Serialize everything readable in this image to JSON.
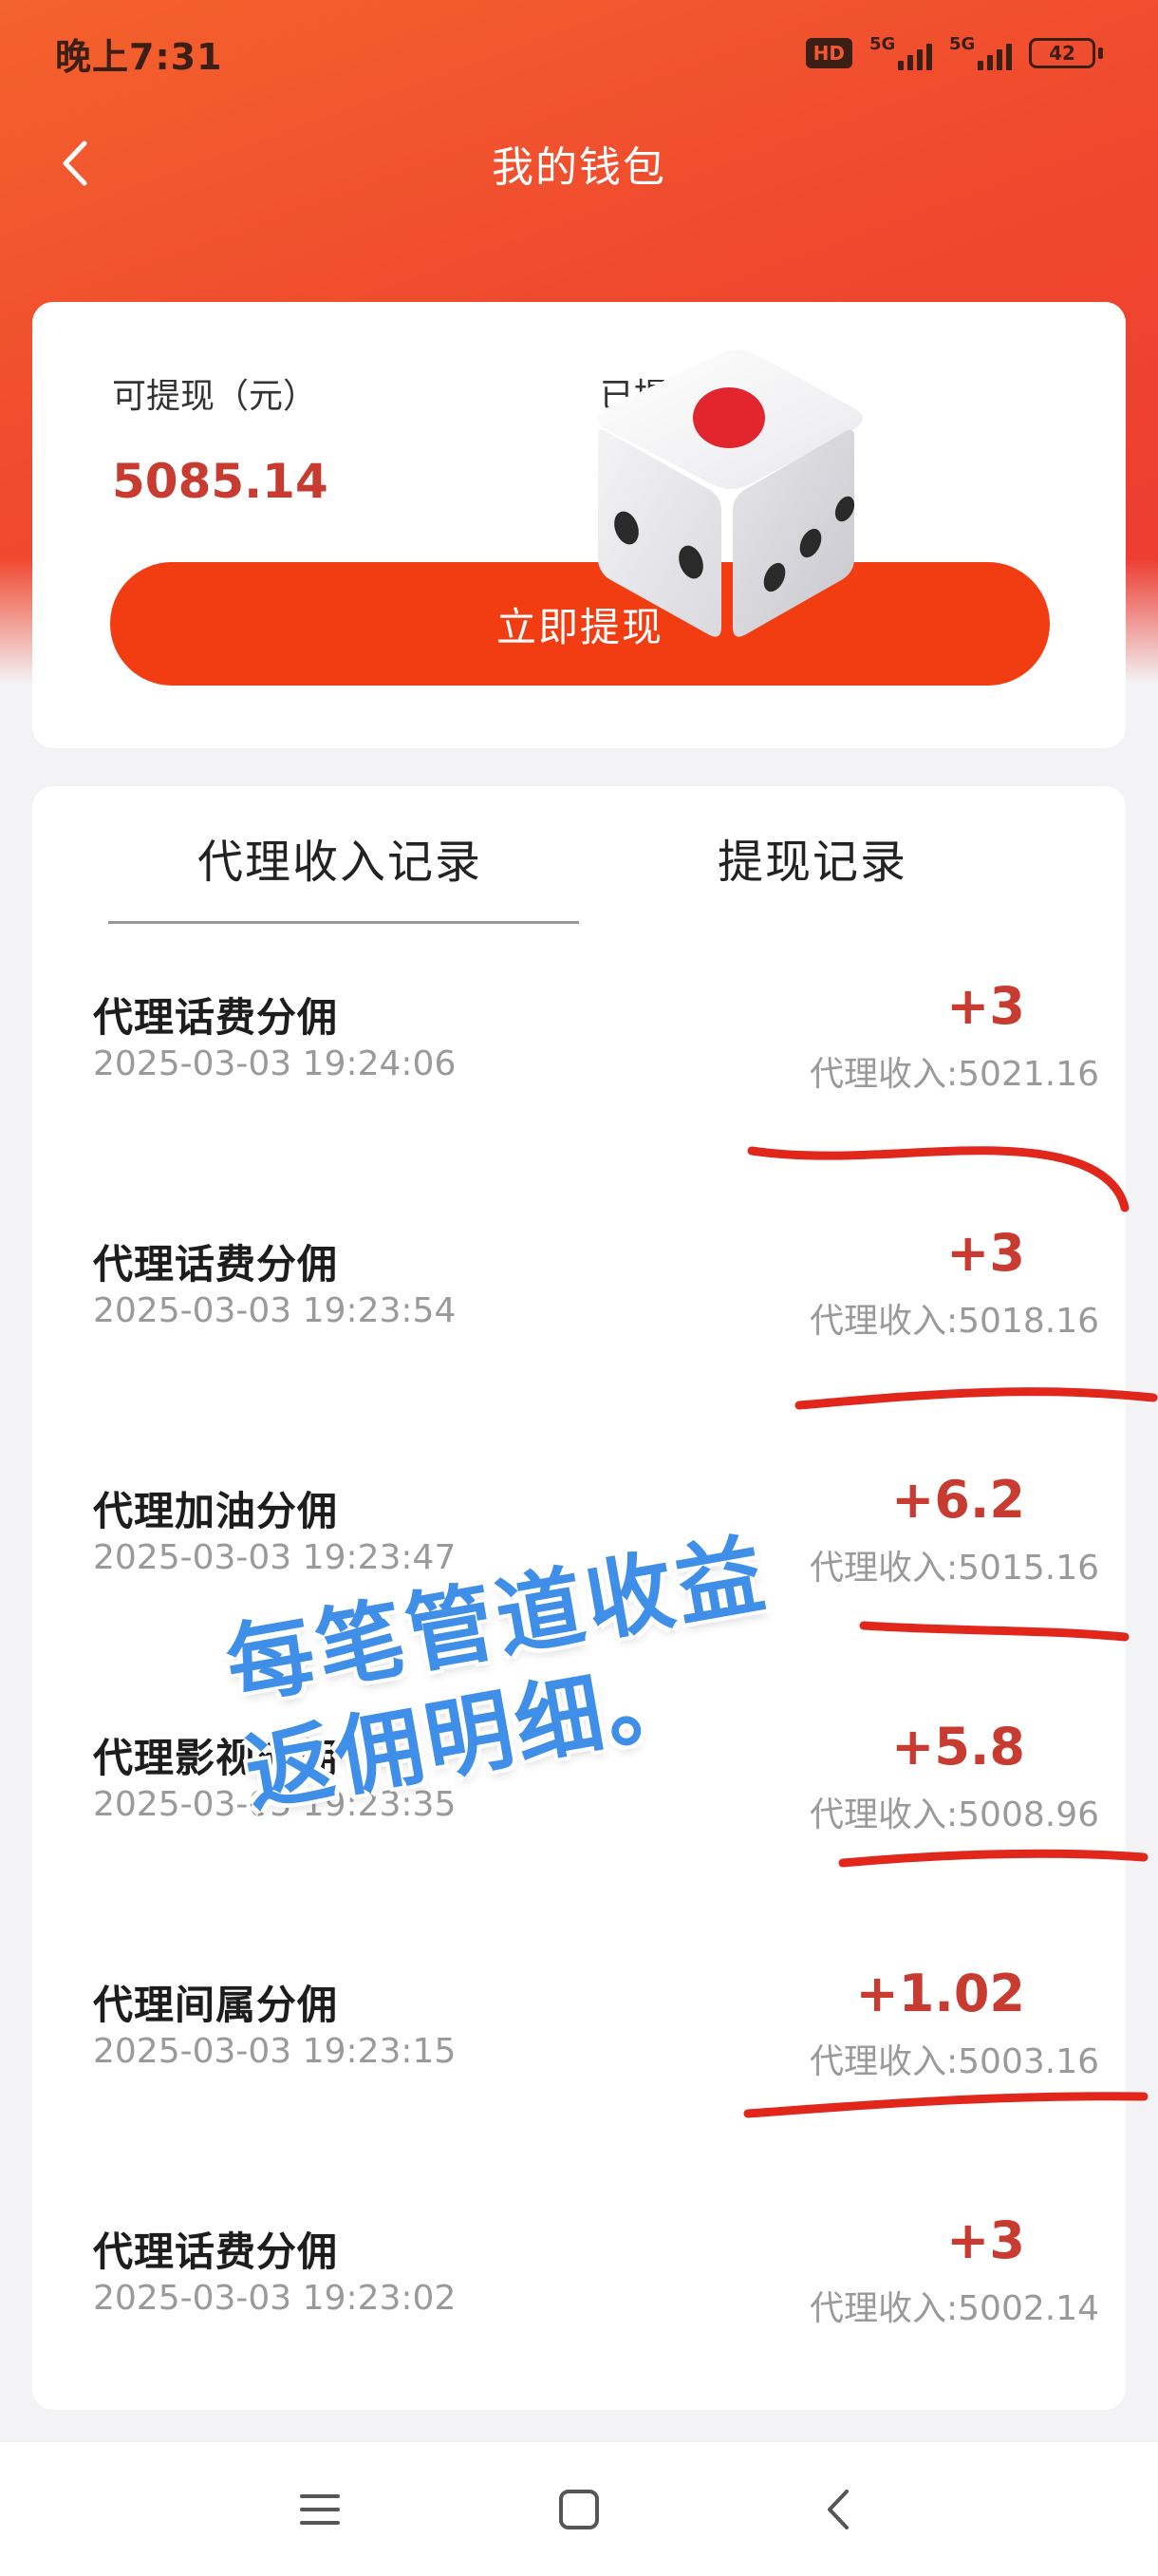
{
  "status_bar": {
    "time": "晚上7:31",
    "hd_label": "HD",
    "network_1": "5G",
    "network_2": "5G",
    "battery": "42"
  },
  "header": {
    "title": "我的钱包",
    "back_icon": "chevron-left-icon"
  },
  "wallet": {
    "withdrawable_label": "可提现（元）",
    "withdrawable_value": "5085.14",
    "withdrawn_label": "已提现（元）",
    "withdraw_button": "立即提现"
  },
  "tabs": [
    {
      "label": "代理收入记录",
      "active": true
    },
    {
      "label": "提现记录",
      "active": false
    }
  ],
  "records": [
    {
      "title": "代理话费分佣",
      "time": "2025-03-03 19:24:06",
      "amount": "+3",
      "income": "代理收入:5021.16"
    },
    {
      "title": "代理话费分佣",
      "time": "2025-03-03 19:23:54",
      "amount": "+3",
      "income": "代理收入:5018.16"
    },
    {
      "title": "代理加油分佣",
      "time": "2025-03-03 19:23:47",
      "amount": "+6.2",
      "income": "代理收入:5015.16"
    },
    {
      "title": "代理影视分佣",
      "time": "2025-03-03 19:23:35",
      "amount": "+5.8",
      "income": "代理收入:5008.96"
    },
    {
      "title": "代理间属分佣",
      "time": "2025-03-03 19:23:15",
      "amount": "+1.02",
      "income": "代理收入:5003.16"
    },
    {
      "title": "代理话费分佣",
      "time": "2025-03-03 19:23:02",
      "amount": "+3",
      "income": "代理收入:5002.14"
    }
  ],
  "overlay": {
    "line1": "每笔管道收益",
    "line2": "返佣明细。"
  },
  "colors": {
    "header": "#f04a2e",
    "accent_red": "#c73b31",
    "button": "#f23c12",
    "overlay_text": "#3f8fe8"
  },
  "bottom_nav": {
    "icons": [
      "menu-icon",
      "home-square-icon",
      "back-triangle-icon"
    ]
  }
}
